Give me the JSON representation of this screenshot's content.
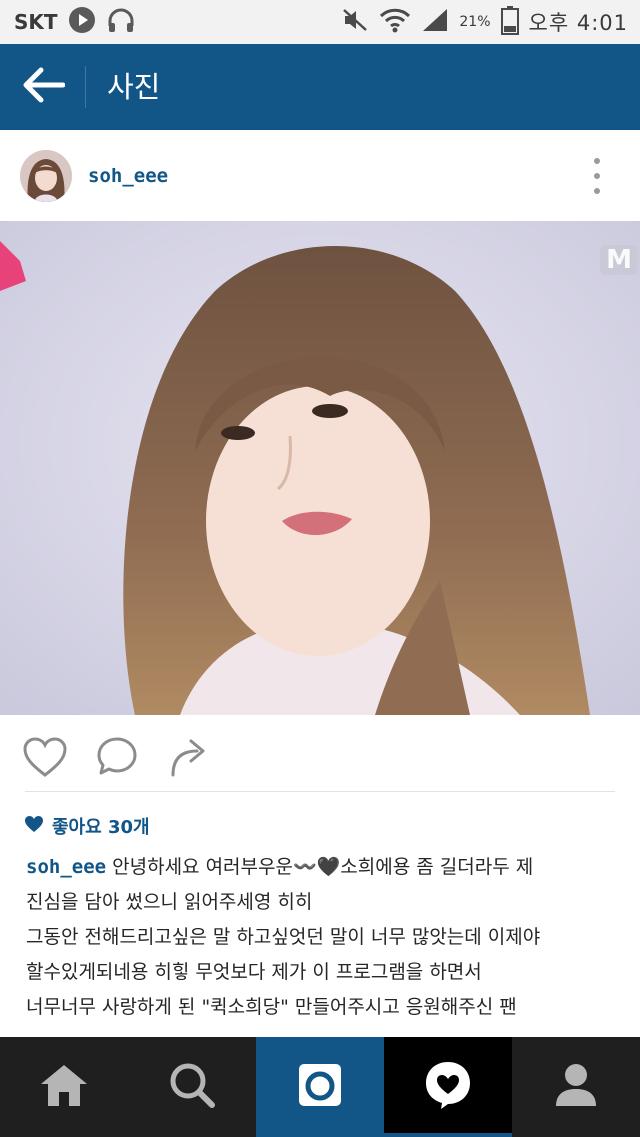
{
  "status_bar": {
    "carrier": "SKT",
    "battery": "21%",
    "time": "오후 4:01"
  },
  "header": {
    "title": "사진"
  },
  "post": {
    "username": "soh_eee",
    "watermark": "M",
    "likes": "좋아요 30개",
    "caption": {
      "username": "soh_eee",
      "first_line": "안녕하세요 여러부우운〰️🖤소희에용 좀 길더라두 제",
      "lines": [
        "진심을 담아 썼으니 읽어주세영 히히",
        "그동안 전해드리고싶은 말 하고싶엇던 말이 너무 많앗는데 이제야",
        "할수있게되네용  히힣 무엇보다 제가 이 프로그램을 하면서",
        "너무너무 사랑하게 된 \"퀵소희당\" 만들어주시고 응원해주신 팬"
      ]
    }
  },
  "colors": {
    "brand": "#125688",
    "status_bar": "#f2f2f2",
    "nav": "#1f1f1f"
  },
  "icons": {
    "back": "arrow-left-icon",
    "more": "more-vertical-icon",
    "like": "heart-outline-icon",
    "comment": "comment-icon",
    "share": "share-arrow-icon",
    "nav": [
      "home-icon",
      "search-icon",
      "camera-icon",
      "activity-heart-icon",
      "profile-icon"
    ]
  }
}
